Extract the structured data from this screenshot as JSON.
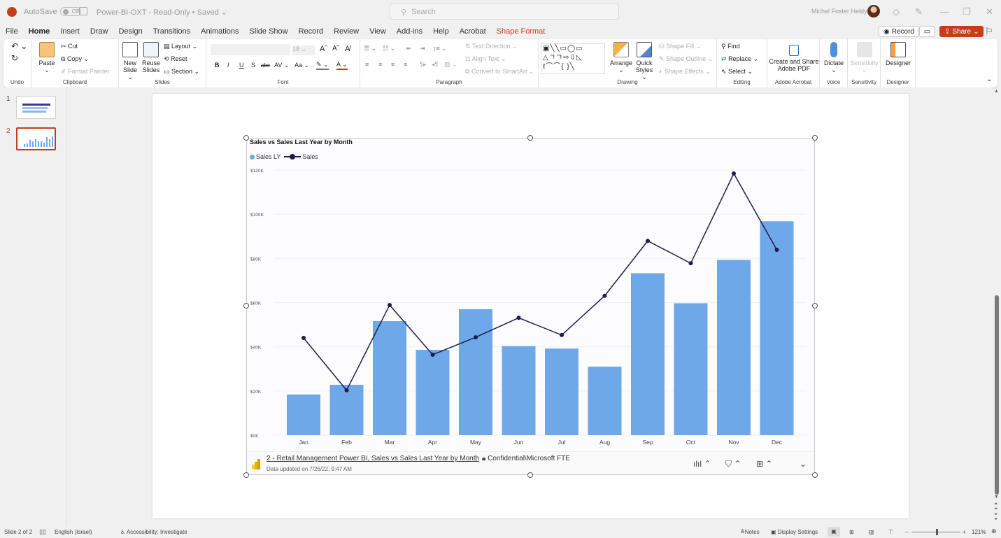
{
  "titlebar": {
    "autosave_label": "AutoSave",
    "autosave_state": "Off",
    "doc_title": "Power-BI-OXT - Read-Only • Saved ⌄",
    "search_placeholder": "Search",
    "user_name": "Michal Foster Heldy",
    "minimize": "—",
    "restore": "❐",
    "close": "✕"
  },
  "menu_tabs": [
    {
      "label": "File"
    },
    {
      "label": "Home"
    },
    {
      "label": "Insert"
    },
    {
      "label": "Draw"
    },
    {
      "label": "Design"
    },
    {
      "label": "Transitions"
    },
    {
      "label": "Animations"
    },
    {
      "label": "Slide Show"
    },
    {
      "label": "Record"
    },
    {
      "label": "Review"
    },
    {
      "label": "View"
    },
    {
      "label": "Add-ins"
    },
    {
      "label": "Help"
    },
    {
      "label": "Acrobat"
    },
    {
      "label": "Shape Format"
    }
  ],
  "tab_buttons": {
    "record": "Record",
    "share": "Share"
  },
  "ribbon": {
    "undo": {
      "label": "Undo"
    },
    "clipboard": {
      "label": "Clipboard",
      "paste": "Paste",
      "cut": "Cut",
      "copy": "Copy",
      "format_painter": "Format Painter"
    },
    "slides": {
      "label": "Slides",
      "new_slide": "New Slide ⌄",
      "new_slide_1": "New",
      "new_slide_2": "Slide ⌄",
      "reuse_1": "Reuse",
      "reuse_2": "Slides",
      "layout": "Layout ⌄",
      "reset": "Reset",
      "section": "Section ⌄"
    },
    "font": {
      "label": "Font",
      "size": "18",
      "bold": "B",
      "italic": "I",
      "underline": "U",
      "shadow": "S",
      "strike": "abc",
      "spacing": "AV ⌄",
      "case": "Aa ⌄"
    },
    "paragraph": {
      "label": "Paragraph",
      "text_direction": "Text Direction ⌄",
      "align_text": "Align Text ⌄",
      "smartart": "Convert to SmartArt ⌄"
    },
    "drawing": {
      "label": "Drawing",
      "arrange_1": "Arrange",
      "arrange_2": "⌄",
      "quick_1": "Quick",
      "quick_2": "Styles ⌄",
      "shape_fill": "Shape Fill ⌄",
      "shape_outline": "Shape Outline ⌄",
      "shape_effects": "Shape Effects ⌄"
    },
    "editing": {
      "label": "Editing",
      "find": "Find",
      "replace": "Replace",
      "select": "Select ⌄"
    },
    "acrobat": {
      "label": "Adobe Acrobat",
      "btn_1": "Create and Share",
      "btn_2": "Adobe PDF"
    },
    "voice": {
      "label": "Voice",
      "dictate": "Dictate"
    },
    "sensitivity": {
      "label": "Sensitivity",
      "btn": "Sensitivity"
    },
    "designer": {
      "label": "Designer",
      "btn": "Designer"
    }
  },
  "slides_pane": [
    {
      "number": "1"
    },
    {
      "number": "2"
    }
  ],
  "visual_footer": {
    "link": "2 - Retail Management Power BI, Sales vs Sales Last Year by Month",
    "separator": "|",
    "classification": "Confidential\\Microsoft FTE",
    "updated": "Data updated on 7/26/22, 9:47 AM"
  },
  "statusbar": {
    "slide_info": "Slide 2 of 2",
    "language": "English (Israel)",
    "accessibility": "Accessibility: Investigate",
    "notes": "Notes",
    "display_settings": "Display Settings",
    "zoom_minus": "−",
    "zoom_plus": "+",
    "zoom_level": "121%"
  },
  "colors": {
    "accent": "#c43e1c",
    "bar": "#6fa8e8",
    "line": "#1f1b4d"
  },
  "chart_data": {
    "type": "bar",
    "title": "Sales vs Sales Last Year by Month",
    "xlabel": "",
    "ylabel": "",
    "categories": [
      "Jan",
      "Feb",
      "Mar",
      "Apr",
      "May",
      "Jun",
      "Jul",
      "Aug",
      "Sep",
      "Oct",
      "Nov",
      "Dec"
    ],
    "series": [
      {
        "name": "Sales LY",
        "kind": "bar",
        "values": [
          18.4,
          22.8,
          51.6,
          38.6,
          57.0,
          40.3,
          39.2,
          31.0,
          73.3,
          59.7,
          79.3,
          96.8
        ]
      },
      {
        "name": "Sales",
        "kind": "line",
        "values": [
          44.0,
          20.3,
          58.9,
          36.4,
          44.3,
          53.1,
          45.3,
          63.1,
          87.9,
          77.8,
          118.4,
          83.9
        ]
      }
    ],
    "units": "thousands USD",
    "ylim": [
      0,
      120
    ],
    "yticks": [
      "$0K",
      "$20K",
      "$40K",
      "$60K",
      "$80K",
      "$100K",
      "$120K"
    ],
    "grid": true,
    "legend": "top-left"
  }
}
